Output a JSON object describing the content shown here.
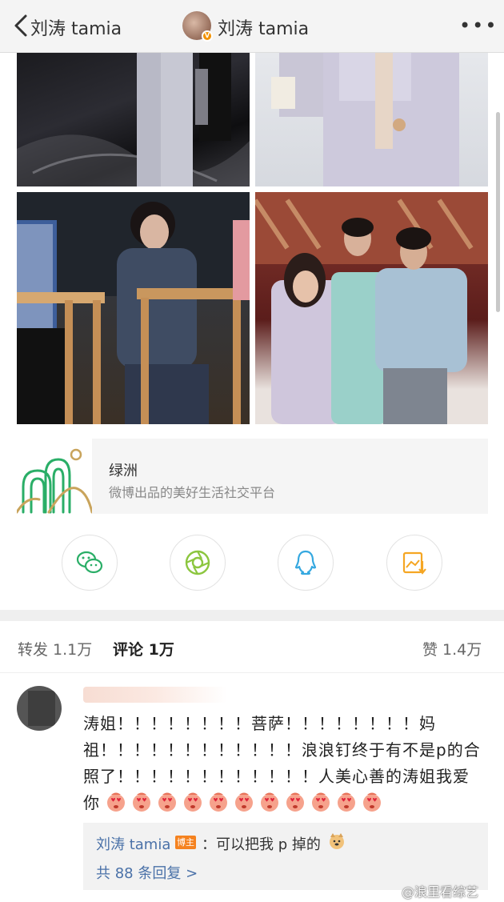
{
  "nav": {
    "back_label": "刘涛 tamia",
    "title": "刘涛 tamia",
    "more_label": "•••"
  },
  "oasis": {
    "title": "绿洲",
    "subtitle": "微博出品的美好生活社交平台"
  },
  "share": [
    "wechat-icon",
    "moments-icon",
    "qq-icon",
    "save-image-icon"
  ],
  "tabs": {
    "forward": "转发 1.1万",
    "comment": "评论 1万",
    "like": "赞 1.4万"
  },
  "comment": {
    "text": "涛姐！！！！！！！！菩萨！！！！！！！！妈祖！！！！！！！！！！！！浪浪钉终于有不是p的合照了！！！！！！！！！！！！人美心善的涛姐我爱你",
    "emoji_count": 11,
    "reply": {
      "author": "刘涛 tamia",
      "badge": "博主",
      "text": "：可以把我 p 掉的",
      "count_label": "共 88 条回复 >"
    }
  },
  "watermark": "@浪里看综艺",
  "colors": {
    "link": "#4a71a8",
    "badge": "#f5821f",
    "wechat": "#2aae67",
    "moments": "#8cc63f",
    "qq": "#35a8e0",
    "save": "#f5a623"
  }
}
